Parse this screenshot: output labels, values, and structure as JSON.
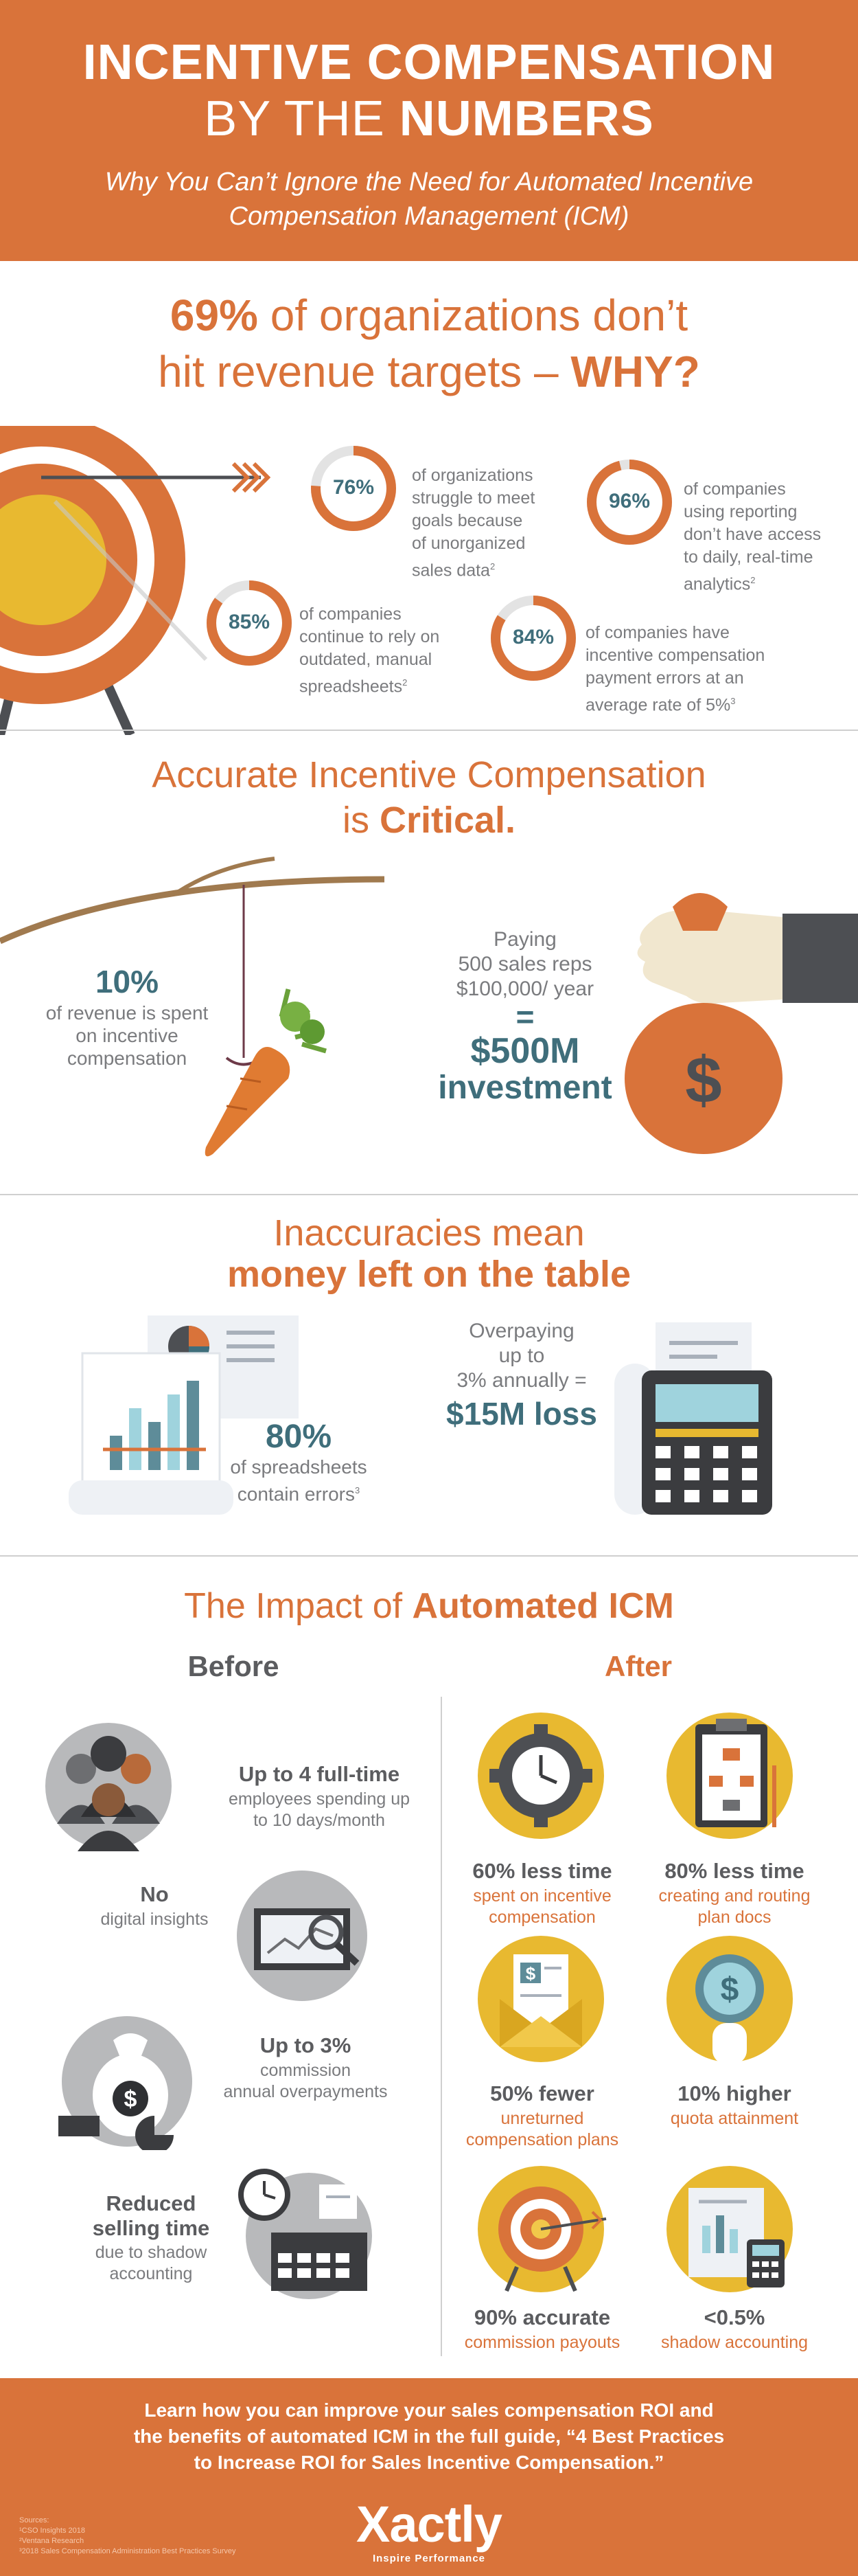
{
  "header": {
    "title_line1": "INCENTIVE COMPENSATION",
    "title_line2_prefix": "BY THE ",
    "title_line2_bold": "NUMBERS",
    "subtitle": "Why You Can’t Ignore the Need for Automated Incentive Compensation Management (ICM)"
  },
  "section1": {
    "title_pct": "69%",
    "title_part1": " of organizations don’t",
    "title_part2": "hit revenue targets – ",
    "title_why": "WHY?",
    "stats": [
      {
        "value": "76%",
        "fraction": 0.76,
        "text_lines": [
          "of organizations",
          "struggle to meet",
          "goals because",
          "of unorganized",
          "sales data"
        ],
        "sup": "2"
      },
      {
        "value": "96%",
        "fraction": 0.96,
        "text_lines": [
          "of companies",
          "using reporting",
          "don’t have access",
          "to daily, real-time",
          "analytics"
        ],
        "sup": "2"
      },
      {
        "value": "85%",
        "fraction": 0.85,
        "text_lines": [
          "of companies",
          "continue to rely on",
          "outdated, manual",
          "spreadsheets"
        ],
        "sup": "2"
      },
      {
        "value": "84%",
        "fraction": 0.84,
        "text_lines": [
          "of companies have",
          "incentive compensation",
          "payment errors at an",
          "average rate of 5%"
        ],
        "sup": "3"
      }
    ]
  },
  "section2": {
    "title_line1": "Accurate Incentive Compensation",
    "title_line2_prefix": "is ",
    "title_line2_bold": "Critical.",
    "pct": "10%",
    "pct_text_lines": [
      "of revenue is spent",
      "on incentive",
      "compensation"
    ],
    "paying_lines": [
      "Paying",
      "500 sales reps",
      "$100,000/ year"
    ],
    "equals": "=",
    "amount": "$500M",
    "amount_label": "investment",
    "bag_symbol": "$"
  },
  "section3": {
    "title_line1": "Inaccuracies mean",
    "title_line2": "money left on the table",
    "pct": "80%",
    "pct_text_lines": [
      "of spreadsheets",
      "contain errors"
    ],
    "pct_sup": "3",
    "overpay_lines": [
      "Overpaying",
      "up to",
      "3% annually ="
    ],
    "loss": "$15M loss"
  },
  "impact": {
    "title_prefix": "The Impact of ",
    "title_bold": "Automated ICM",
    "before_label": "Before",
    "after_label": "After",
    "before_items": [
      {
        "bold": "Up to 4 full-time",
        "sub_lines": [
          "employees spending up",
          "to 10 days/month"
        ]
      },
      {
        "bold": "No",
        "sub_lines": [
          "digital insights"
        ]
      },
      {
        "bold": "Up to 3%",
        "sub_lines": [
          "commission",
          "annual overpayments"
        ]
      },
      {
        "bold_lines": [
          "Reduced",
          "selling time"
        ],
        "sub_lines": [
          "due to shadow",
          "accounting"
        ]
      }
    ],
    "after_items": [
      {
        "bold": "60% less time",
        "sub_lines": [
          "spent on incentive",
          "compensation"
        ]
      },
      {
        "bold": "80% less time",
        "sub_lines": [
          "creating and routing",
          "plan docs"
        ]
      },
      {
        "bold": "50% fewer",
        "sub_lines": [
          "unreturned",
          "compensation plans"
        ]
      },
      {
        "bold": "10% higher",
        "sub_lines": [
          "quota attainment"
        ]
      },
      {
        "bold": "90% accurate",
        "sub_lines": [
          "commission payouts"
        ]
      },
      {
        "bold": "<0.5%",
        "sub_lines": [
          "shadow accounting"
        ]
      }
    ]
  },
  "footer": {
    "cta_lines": [
      "Learn how you can improve your sales compensation ROI and",
      "the benefits of automated ICM in the full guide, “4 Best Practices",
      "to Increase ROI for Sales Incentive Compensation.”"
    ],
    "logo": "Xactly",
    "tagline": "Inspire Performance",
    "sources": [
      "Sources:",
      "¹CSO Insights 2018",
      "²Ventana Research",
      "³2018 Sales Compensation Administration Best Practices Survey"
    ]
  },
  "colors": {
    "orange": "#d9733a",
    "teal": "#3f6e7b",
    "yellow": "#e8b930",
    "gray": "#6d6e71"
  }
}
